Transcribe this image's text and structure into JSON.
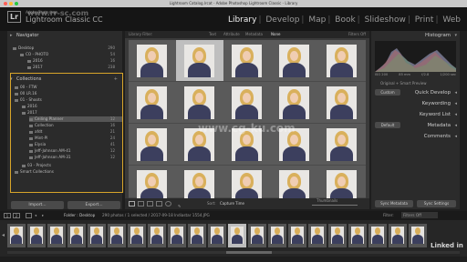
{
  "window": {
    "title": "Lightroom Catalog.lrcat - Adobe Photoshop Lightroom Classic - Library",
    "traffic_lights": [
      "#ff5f57",
      "#ffbd2e",
      "#28c940"
    ]
  },
  "brand": {
    "logo_text": "Lr",
    "small": "Adobe Photoshop",
    "big": "Lightroom Classic CC"
  },
  "modules": [
    "Library",
    "Develop",
    "Map",
    "Book",
    "Slideshow",
    "Print",
    "Web"
  ],
  "active_module": "Library",
  "left_panel": {
    "navigator": "Navigator",
    "folders": [
      {
        "label": "Desktop",
        "count": "290"
      },
      {
        "label": "CO - PHOTO",
        "count": "54"
      },
      {
        "label": "2016",
        "count": "16"
      },
      {
        "label": "2017",
        "count": "238"
      }
    ],
    "collections_header": "Collections",
    "collections": [
      {
        "label": "00 - FTW",
        "count": ""
      },
      {
        "label": "00 LR.16",
        "count": ""
      },
      {
        "label": "01 - Shoots",
        "count": ""
      },
      {
        "label": "2016",
        "count": ""
      },
      {
        "label": "2017",
        "count": ""
      },
      {
        "label": "Ceiling Planner",
        "count": "12"
      },
      {
        "label": "Collection",
        "count": "16"
      },
      {
        "label": "afdt",
        "count": "21"
      },
      {
        "label": "Mint-Pl",
        "count": "24"
      },
      {
        "label": "Elysia",
        "count": "41"
      },
      {
        "label": "Jeff-Johnson AM-41",
        "count": "12"
      },
      {
        "label": "Jeff-Johnson AM-31",
        "count": "12"
      },
      {
        "label": "03 - Projects",
        "count": ""
      },
      {
        "label": "Smart Collections",
        "count": ""
      }
    ],
    "import_label": "Import...",
    "export_label": "Export..."
  },
  "library_filter": {
    "label": "Library Filter:",
    "options": [
      "Text",
      "Attribute",
      "Metadata",
      "None"
    ],
    "preset": "Filters Off"
  },
  "grid": {
    "columns": 5,
    "rows": 4,
    "selected_index": 1
  },
  "toolbar": {
    "sort_label": "Sort:",
    "sort_value": "Capture Time",
    "thumbnails_label": "Thumbnails"
  },
  "right_panel": {
    "histogram": "Histogram",
    "histogram_readout": [
      "ISO 200",
      "85 mm",
      "f/2.8",
      "1/200 sec"
    ],
    "photo_info": "Original + Smart Preview",
    "custom_label": "Custom",
    "default_label": "Default",
    "sections": [
      "Quick Develop",
      "Keywording",
      "Keyword List",
      "Metadata",
      "Comments"
    ],
    "sync_label": "Sync Settings",
    "sync_metadata": "Sync Metadata"
  },
  "filmstrip": {
    "source": "Folder : Desktop",
    "info": "290 photos / 1 selected / 2017-09-18 Indiastar 1554.JPG",
    "filter_label": "Filter:",
    "filter_value": "Filters Off",
    "page_buttons": [
      "1",
      "2"
    ]
  },
  "watermarks": [
    "www.rr-sc.com",
    "www.cg-ku.com"
  ],
  "linkedin": "Linked in"
}
